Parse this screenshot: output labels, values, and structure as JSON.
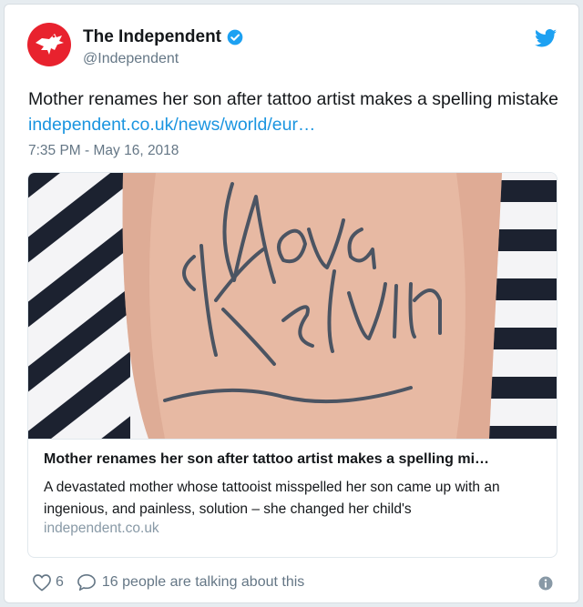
{
  "account": {
    "display_name": "The Independent",
    "handle": "@Independent"
  },
  "icons": {
    "verified": "verified-badge-icon",
    "brand": "twitter-bird-icon",
    "like": "heart-icon",
    "reply": "speech-bubble-icon",
    "info": "info-icon",
    "logo": "independent-eagle-logo"
  },
  "tweet": {
    "text": "Mother renames her son after tattoo artist makes a spelling mistake ",
    "link": "independent.co.uk/news/world/eur…",
    "timestamp": "7:35 PM - May 16, 2018"
  },
  "card": {
    "image_alt": "forearm tattoo reading Nova Kelvin",
    "title": "Mother renames her son after tattoo artist makes a spelling mi…",
    "description": "A devastated mother whose tattooist misspelled her son came up with an ingenious, and painless, solution – she changed her child's",
    "domain": "independent.co.uk"
  },
  "actions": {
    "likes": "6",
    "conversation": "16 people are talking about this"
  },
  "colors": {
    "link": "#1b95e0",
    "verified": "#1da1f2",
    "logo_red": "#e8222e",
    "muted": "#657786"
  }
}
